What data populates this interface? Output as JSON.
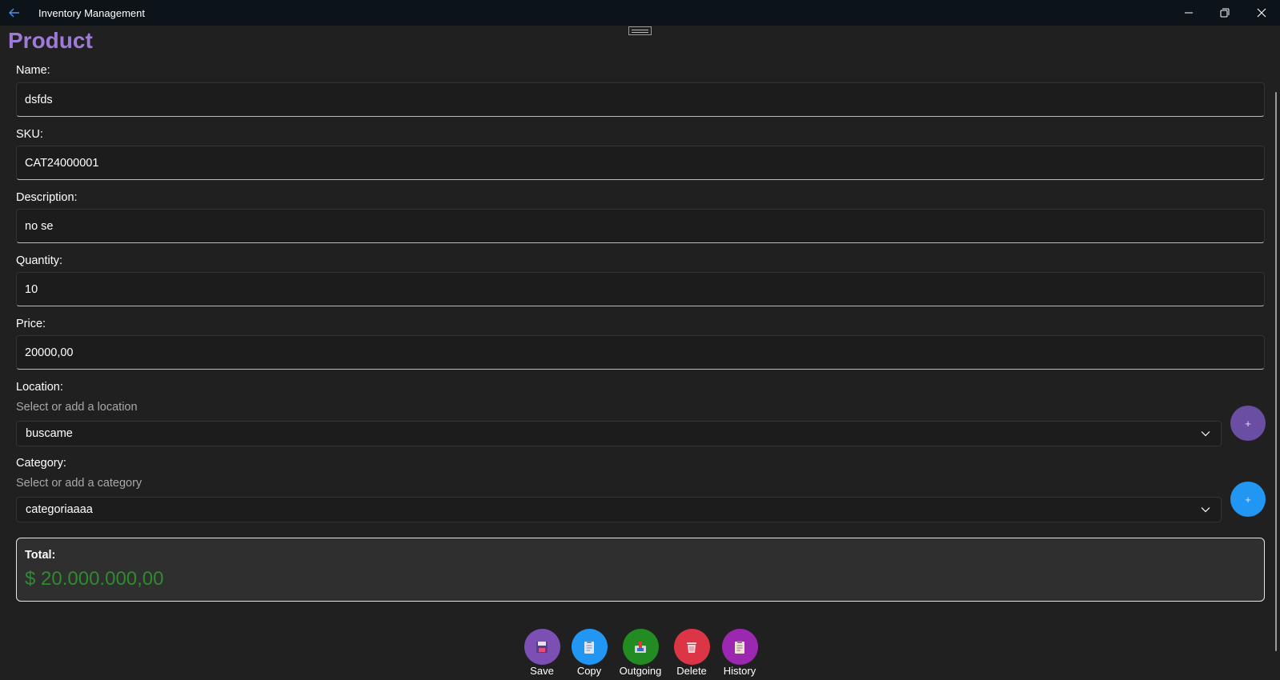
{
  "titlebar": {
    "title": "Inventory Management",
    "back_icon": "arrow-left-icon",
    "minimize_icon": "minimize-icon",
    "restore_icon": "restore-icon",
    "close_icon": "close-icon"
  },
  "page": {
    "title": "Product"
  },
  "fields": {
    "name": {
      "label": "Name:",
      "value": "dsfds"
    },
    "sku": {
      "label": "SKU:",
      "value": "CAT24000001"
    },
    "description": {
      "label": "Description:",
      "value": "no se"
    },
    "quantity": {
      "label": "Quantity:",
      "value": "10"
    },
    "price": {
      "label": "Price:",
      "value": "20000,00"
    }
  },
  "location": {
    "label": "Location:",
    "hint": "Select or add a location",
    "selected": "buscame",
    "add_label": "+"
  },
  "category": {
    "label": "Category:",
    "hint": "Select or add a category",
    "selected": "categoriaaaa",
    "add_label": "+"
  },
  "total": {
    "label": "Total:",
    "value": "$ 20.000.000,00"
  },
  "actions": [
    {
      "label": "Save",
      "icon": "save-icon",
      "color": "#7b4fb3"
    },
    {
      "label": "Copy",
      "icon": "copy-icon",
      "color": "#2196f3"
    },
    {
      "label": "Outgoing",
      "icon": "outgoing-icon",
      "color": "#228b22"
    },
    {
      "label": "Delete",
      "icon": "trash-icon",
      "color": "#dc3545"
    },
    {
      "label": "History",
      "icon": "history-icon",
      "color": "#9c27b0"
    }
  ],
  "colors": {
    "accent_title": "#9e7bd8",
    "location_add": "#6a4ea3",
    "category_add": "#2196f3",
    "total_value": "#2e8b2e"
  }
}
